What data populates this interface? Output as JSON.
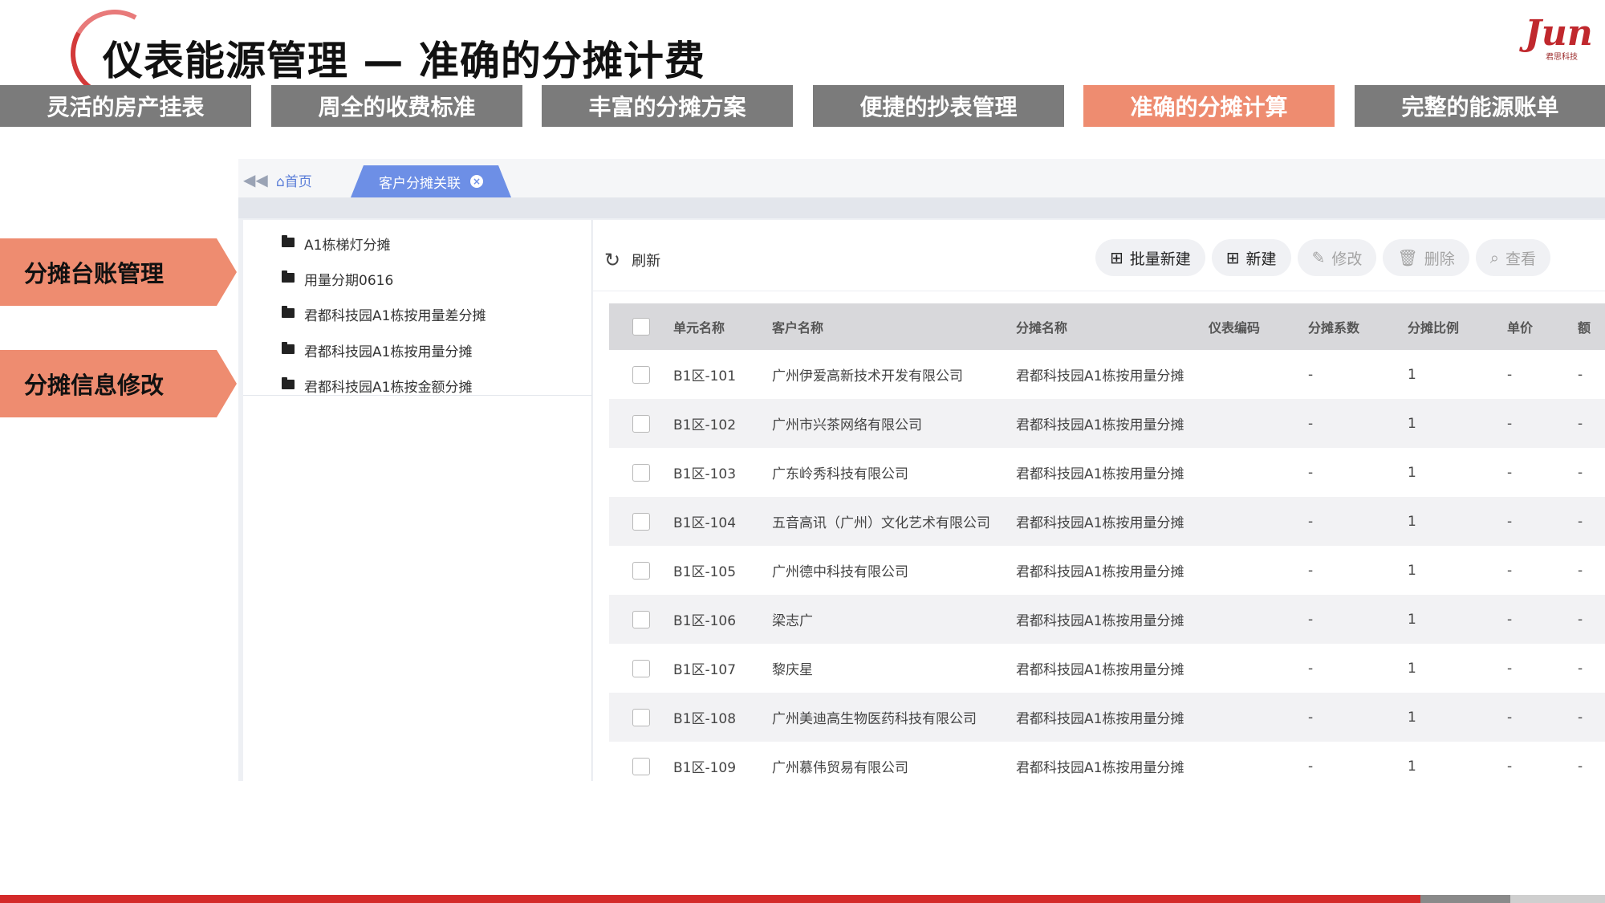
{
  "header": {
    "title": "仪表能源管理 — 准确的分摊计费",
    "logo_text": "Jun",
    "logo_subtext": "君思科技"
  },
  "feature_tabs": [
    {
      "label": "灵活的房产挂表",
      "active": false
    },
    {
      "label": "周全的收费标准",
      "active": false
    },
    {
      "label": "丰富的分摊方案",
      "active": false
    },
    {
      "label": "便捷的抄表管理",
      "active": false
    },
    {
      "label": "准确的分摊计算",
      "active": true
    },
    {
      "label": "完整的能源账单",
      "active": false
    }
  ],
  "side_labels": [
    "分摊台账管理",
    "分摊信息修改"
  ],
  "app": {
    "home_label": "首页",
    "active_tab_label": "客户分摊关联",
    "tree_items": [
      "A1栋梯灯分摊",
      "用量分期0616",
      "君都科技园A1栋按用量差分摊",
      "君都科技园A1栋按用量分摊",
      "君都科技园A1栋按金额分摊"
    ],
    "refresh_label": "刷新",
    "toolbar": {
      "batch_new": "批量新建",
      "new": "新建",
      "edit": "修改",
      "delete": "删除",
      "view": "查看"
    },
    "table": {
      "headers": [
        "单元名称",
        "客户名称",
        "分摊名称",
        "仪表编码",
        "分摊系数",
        "分摊比例",
        "单价",
        "额"
      ],
      "rows": [
        [
          "B1区-101",
          "广州伊爱高新技术开发有限公司",
          "君都科技园A1栋按用量分摊",
          "",
          "-",
          "1",
          "-",
          "-"
        ],
        [
          "B1区-102",
          "广州市兴茶网络有限公司",
          "君都科技园A1栋按用量分摊",
          "",
          "-",
          "1",
          "-",
          "-"
        ],
        [
          "B1区-103",
          "广东岭秀科技有限公司",
          "君都科技园A1栋按用量分摊",
          "",
          "-",
          "1",
          "-",
          "-"
        ],
        [
          "B1区-104",
          "五音高讯（广州）文化艺术有限公司",
          "君都科技园A1栋按用量分摊",
          "",
          "-",
          "1",
          "-",
          "-"
        ],
        [
          "B1区-105",
          "广州德中科技有限公司",
          "君都科技园A1栋按用量分摊",
          "",
          "-",
          "1",
          "-",
          "-"
        ],
        [
          "B1区-106",
          "梁志广",
          "君都科技园A1栋按用量分摊",
          "",
          "-",
          "1",
          "-",
          "-"
        ],
        [
          "B1区-107",
          "黎庆星",
          "君都科技园A1栋按用量分摊",
          "",
          "-",
          "1",
          "-",
          "-"
        ],
        [
          "B1区-108",
          "广州美迪高生物医药科技有限公司",
          "君都科技园A1栋按用量分摊",
          "",
          "-",
          "1",
          "-",
          "-"
        ],
        [
          "B1区-109",
          "广州慕伟贸易有限公司",
          "君都科技园A1栋按用量分摊",
          "",
          "-",
          "1",
          "-",
          "-"
        ]
      ]
    }
  },
  "colors": {
    "accent_orange": "#ee8c70",
    "tab_grey": "#7b7b7b",
    "brand_red": "#d42a2a",
    "app_blue": "#6d8fe6"
  }
}
